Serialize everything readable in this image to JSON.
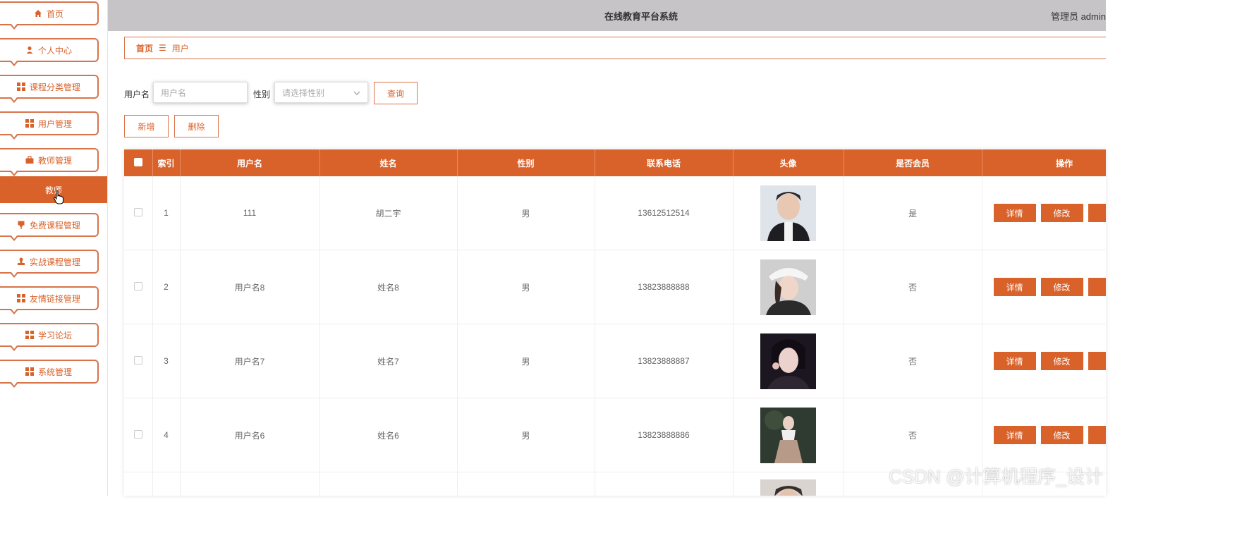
{
  "header": {
    "title": "在线教育平台系统",
    "admin": "管理员 admin"
  },
  "sidebar": {
    "items": [
      {
        "label": "首页",
        "icon": "home-icon"
      },
      {
        "label": "个人中心",
        "icon": "person-icon"
      },
      {
        "label": "课程分类管理",
        "icon": "grid-icon"
      },
      {
        "label": "用户管理",
        "icon": "grid-icon"
      },
      {
        "label": "教师管理",
        "icon": "briefcase-icon"
      },
      {
        "label": "免费课程管理",
        "icon": "pin-icon"
      },
      {
        "label": "实战课程管理",
        "icon": "stamp-icon"
      },
      {
        "label": "友情链接管理",
        "icon": "grid-icon"
      },
      {
        "label": "学习论坛",
        "icon": "grid-icon"
      },
      {
        "label": "系统管理",
        "icon": "grid-icon"
      }
    ],
    "active_sub": "教师"
  },
  "breadcrumb": {
    "home": "首页",
    "separator": "☰",
    "current": "用户"
  },
  "search": {
    "username_label": "用户名",
    "username_placeholder": "用户名",
    "gender_label": "性别",
    "gender_placeholder": "请选择性别",
    "query_button": "查询"
  },
  "actions": {
    "add": "新增",
    "delete": "删除"
  },
  "table": {
    "columns": [
      "索引",
      "用户名",
      "姓名",
      "性别",
      "联系电话",
      "头像",
      "是否会员",
      "操作"
    ],
    "rows": [
      {
        "index": "1",
        "username": "111",
        "name": "胡二宇",
        "gender": "男",
        "phone": "13612512514",
        "member": "是"
      },
      {
        "index": "2",
        "username": "用户名8",
        "name": "姓名8",
        "gender": "男",
        "phone": "13823888888",
        "member": "否"
      },
      {
        "index": "3",
        "username": "用户名7",
        "name": "姓名7",
        "gender": "男",
        "phone": "13823888887",
        "member": "否"
      },
      {
        "index": "4",
        "username": "用户名6",
        "name": "姓名6",
        "gender": "男",
        "phone": "13823888886",
        "member": "否"
      }
    ],
    "op_detail": "详情",
    "op_edit": "修改"
  },
  "watermark": "CSDN @计算机程序_设计",
  "colors": {
    "accent": "#d8622a",
    "topbar": "#c6c4c6"
  }
}
